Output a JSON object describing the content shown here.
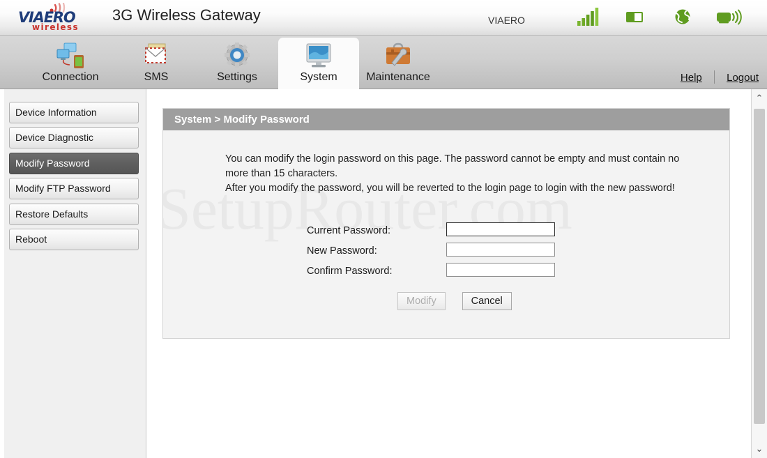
{
  "header": {
    "logo_name": "VIAERO",
    "logo_sub": "wireless",
    "title": "3G Wireless Gateway",
    "carrier": "VIAERO",
    "status_icons": [
      {
        "name": "signal-bars-icon",
        "label": "signal-bars"
      },
      {
        "name": "battery-icon",
        "label": "battery"
      },
      {
        "name": "globe-icon",
        "label": "globe"
      },
      {
        "name": "device-broadcast-icon",
        "label": "device-broadcast"
      }
    ],
    "accent_green": "#5f9c20",
    "logo_blue": "#1f3d7a",
    "logo_red": "#c9342e"
  },
  "nav": {
    "tabs": [
      {
        "label": "Connection",
        "icon": "connection-icon",
        "active": false
      },
      {
        "label": "SMS",
        "icon": "sms-envelope-icon",
        "active": false
      },
      {
        "label": "Settings",
        "icon": "settings-gear-icon",
        "active": false
      },
      {
        "label": "System",
        "icon": "system-monitor-icon",
        "active": true
      },
      {
        "label": "Maintenance",
        "icon": "maintenance-toolbox-icon",
        "active": false
      }
    ],
    "help_label": "Help",
    "logout_label": "Logout"
  },
  "sidebar": {
    "items": [
      {
        "label": "Device Information",
        "active": false
      },
      {
        "label": "Device Diagnostic",
        "active": false
      },
      {
        "label": "Modify Password",
        "active": true
      },
      {
        "label": "Modify FTP Password",
        "active": false
      },
      {
        "label": "Restore Defaults",
        "active": false
      },
      {
        "label": "Reboot",
        "active": false
      }
    ]
  },
  "panel": {
    "breadcrumb": "System > Modify Password",
    "watermark": "SetupRouter.com",
    "description_line1": "You can modify the login password on this page. The password cannot be empty and must contain no more than 15 characters.",
    "description_line2": "After you modify the password, you will be reverted to the login page to login with the new password!",
    "fields": [
      {
        "label": "Current Password:",
        "value": "",
        "placeholder": "",
        "focused": true
      },
      {
        "label": "New Password:",
        "value": "",
        "placeholder": "",
        "focused": false
      },
      {
        "label": "Confirm Password:",
        "value": "",
        "placeholder": "",
        "focused": false
      }
    ],
    "modify_button": "Modify",
    "modify_disabled": true,
    "cancel_button": "Cancel"
  },
  "scrollbar": {
    "up_arrow": "⌃",
    "down_arrow": "⌄"
  }
}
